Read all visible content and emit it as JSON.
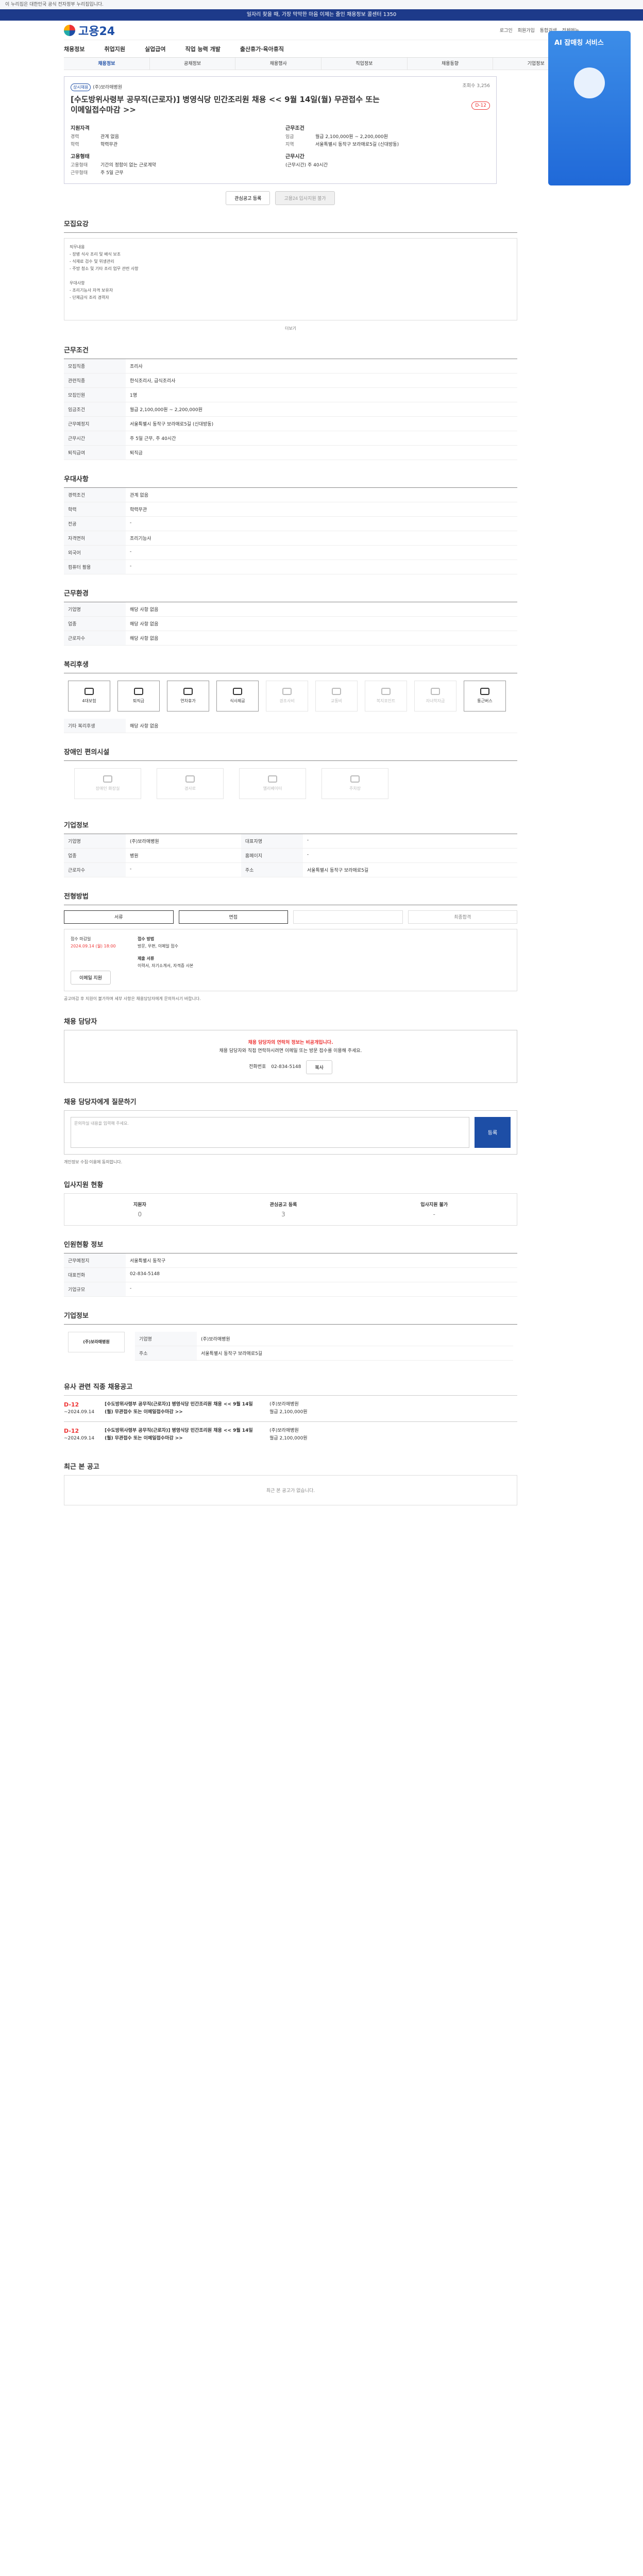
{
  "gov_notice": "이 누리집은 대한민국 공식 전자정부 누리집입니다.",
  "top_banner": "일자리 찾을 때, 가장 막막한 마음 이제는 줄인 채용정보 콜센터 1350",
  "brand": "고용24",
  "util": [
    "로그인",
    "회원가입",
    "통합검색",
    "전체메뉴"
  ],
  "gnb": [
    "채용정보",
    "취업지원",
    "실업급여",
    "직업 능력 개발",
    "출산휴가·육아휴직"
  ],
  "subnav": [
    "채용정보",
    "공채정보",
    "채용행사",
    "직업정보",
    "채용동향",
    "기업정보"
  ],
  "side_banner": "AI 잡매칭 서비스",
  "job": {
    "tag": "상시채용",
    "company": "(주)보라매병원",
    "title": "[수도방위사령부 공무직(근로자)] 병영식당 민간조리원 채용 << 9월 14일(월) 무관접수 또는 이메일접수마감 >>",
    "dday": "D-12",
    "views": "조회수 3,256",
    "req_title": "지원자격",
    "cond_title": "근무조건",
    "career_k": "경력",
    "career_v": "관계 없음",
    "edu_k": "학력",
    "edu_v": "학력무관",
    "pay_k": "임금",
    "pay_v": "월급 2,100,000원 ~ 2,200,000원",
    "loc_k": "지역",
    "loc_v": "서울특별시 동작구 보라매로5길 (신대방동)",
    "type_title": "고용형태",
    "hours_title": "근무시간",
    "type_k": "고용형태",
    "type_v": "기간의 정함이 없는 근로계약",
    "time_k": "근무형태",
    "time_v": "주 5일 근무",
    "hours_v": "(근무시간) 주 40시간",
    "btn_scrap": "관심공고 등록",
    "btn_apply": "고용24 입사지원 불가"
  },
  "sections": {
    "detail": "모집요강",
    "more": "더보기",
    "recruit": "근무조건",
    "prefer": "우대사항",
    "benefit": "근무환경",
    "welfare": "복리후생",
    "other": "기타 복리후생",
    "disab": "장애인 편의시설",
    "company": "기업정보",
    "proc": "전형방법",
    "howto": "접수방법",
    "contact": "채용 담당자",
    "inquiry": "채용 담당자에게 질문하기",
    "like": "입사지원 현황",
    "stats": "인원현황 정보",
    "coinfo": "기업정보",
    "similar": "유사 관련 직종 채용공고",
    "recent": "최근 본 공고"
  },
  "detail_text": [
    "직무내용",
    "- 장병 식사 조리 및 배식 보조",
    "- 식재료 검수 및 위생관리",
    "- 주방 청소 및 기타 조리 업무 관련 사항",
    "",
    "우대사항",
    "- 조리기능사 자격 보유자",
    "- 단체급식 조리 경력자"
  ],
  "cond_rows": [
    [
      "모집직종",
      "조리사"
    ],
    [
      "관련직종",
      "한식조리사, 급식조리사"
    ],
    [
      "모집인원",
      "1명"
    ],
    [
      "임금조건",
      "월급 2,100,000원 ~ 2,200,000원"
    ],
    [
      "근무예정지",
      "서울특별시 동작구 보라매로5길 (신대방동)"
    ],
    [
      "근무시간",
      "주 5일 근무, 주 40시간"
    ],
    [
      "퇴직급여",
      "퇴직금"
    ]
  ],
  "req_rows": [
    [
      "경력조건",
      "관계 없음"
    ],
    [
      "학력",
      "학력무관"
    ],
    [
      "전공",
      "-"
    ],
    [
      "자격면허",
      "조리기능사"
    ],
    [
      "외국어",
      "-"
    ],
    [
      "컴퓨터 활용",
      "-"
    ]
  ],
  "welfare_icons": [
    "4대보험",
    "퇴직금",
    "연차휴가",
    "식사제공",
    "경조사비",
    "교통비",
    "복지포인트",
    "자녀학자금",
    "통근버스",
    "휴게실"
  ],
  "disab_icons": [
    "장애인 화장실",
    "경사로",
    "엘리베이터",
    "주차장"
  ],
  "none": "해당 사항 없음",
  "company_rows": [
    [
      "기업명",
      "(주)보라매병원"
    ],
    [
      "업종",
      "병원"
    ],
    [
      "근로자수",
      "-"
    ],
    [
      "대표자명",
      "-"
    ],
    [
      "홈페이지",
      "-"
    ],
    [
      "주소",
      "서울특별시 동작구 보라매로5길"
    ]
  ],
  "proc_steps": [
    "서류",
    "면접",
    "",
    "최종합격"
  ],
  "apply": {
    "deadline_k": "접수 마감일",
    "deadline_v": "2024.09.14 (월) 18:00",
    "method_k": "접수 방법",
    "method_v": "방문, 우편, 이메일 접수",
    "docs_k": "제출 서류",
    "docs_v": "이력서, 자기소개서, 자격증 사본",
    "btn": "이메일 지원"
  },
  "notice": "공고마감 후 지원이 불가하며 세부 사항은 채용담당자에게 문의하시기 바랍니다.",
  "warn": {
    "t1": "채용 담당자의 연락처 정보는 비공개입니다.",
    "t2": "채용 담당자와 직접 연락하시려면 이메일 또는 방문 접수를 이용해 주세요.",
    "tel_k": "전화번호",
    "tel_v": "02-834-5148",
    "btn": "복사"
  },
  "inq": {
    "ph": "문의하실 내용을 입력해 주세요.",
    "send": "등록",
    "agree": "개인정보 수집·이용에 동의합니다."
  },
  "likes": [
    [
      "지원자",
      "0"
    ],
    [
      "관심공고 등록",
      "3"
    ],
    [
      "입사지원 불가",
      "-"
    ]
  ],
  "stats_rows": [
    [
      "근무예정지",
      "서울특별시 동작구"
    ],
    [
      "대표전화",
      "02-834-5148"
    ],
    [
      "기업규모",
      "-"
    ]
  ],
  "similar": [
    {
      "d": "D-12",
      "date": "~2024.09.14",
      "t": "[수도방위사령부 공무직(근로자)] 병영식당 민간조리원 채용 << 9월 14일(월) 무관접수 또는 이메일접수마감 >>",
      "c": "(주)보라매병원",
      "pay": "월급 2,100,000원"
    },
    {
      "d": "D-12",
      "date": "~2024.09.14",
      "t": "[수도방위사령부 공무직(근로자)] 병영식당 민간조리원 채용 << 9월 14일(월) 무관접수 또는 이메일접수마감 >>",
      "c": "(주)보라매병원",
      "pay": "월급 2,100,000원"
    }
  ],
  "recent_empty": "최근 본 공고가 없습니다."
}
